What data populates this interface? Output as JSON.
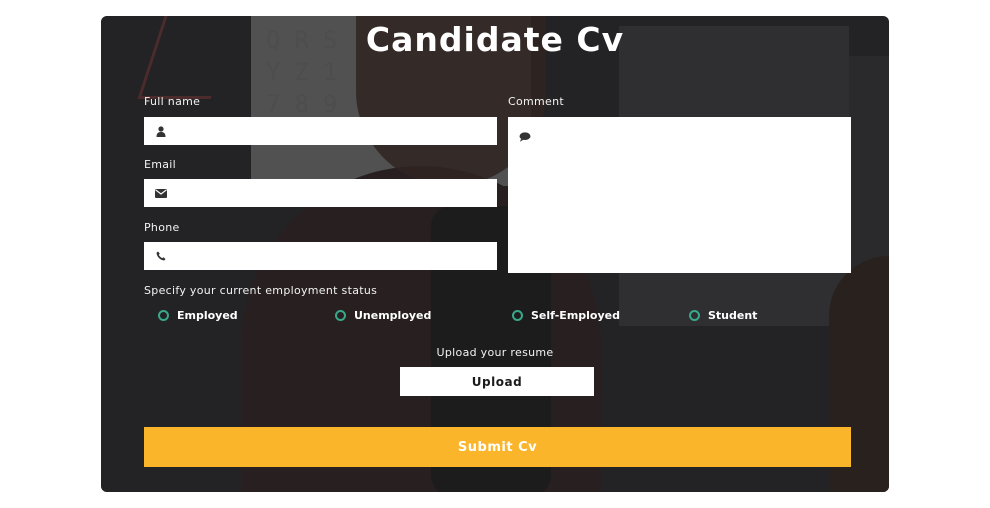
{
  "form": {
    "title": "Candidate Cv",
    "fields": {
      "full_name": {
        "label": "Full name",
        "value": ""
      },
      "email": {
        "label": "Email",
        "value": ""
      },
      "phone": {
        "label": "Phone",
        "value": ""
      },
      "comment": {
        "label": "Comment",
        "value": ""
      }
    },
    "employment": {
      "label": "Specify your current employment status",
      "options": [
        "Employed",
        "Unemployed",
        "Self-Employed",
        "Student"
      ]
    },
    "upload": {
      "label": "Upload your resume",
      "button": "Upload"
    },
    "submit": {
      "label": "Submit Cv"
    }
  },
  "icons": {
    "full_name": "user-icon",
    "email": "envelope-icon",
    "phone": "phone-icon",
    "comment": "comment-icon"
  },
  "colors": {
    "accent": "#fbb52b",
    "radio": "#39a88a"
  }
}
